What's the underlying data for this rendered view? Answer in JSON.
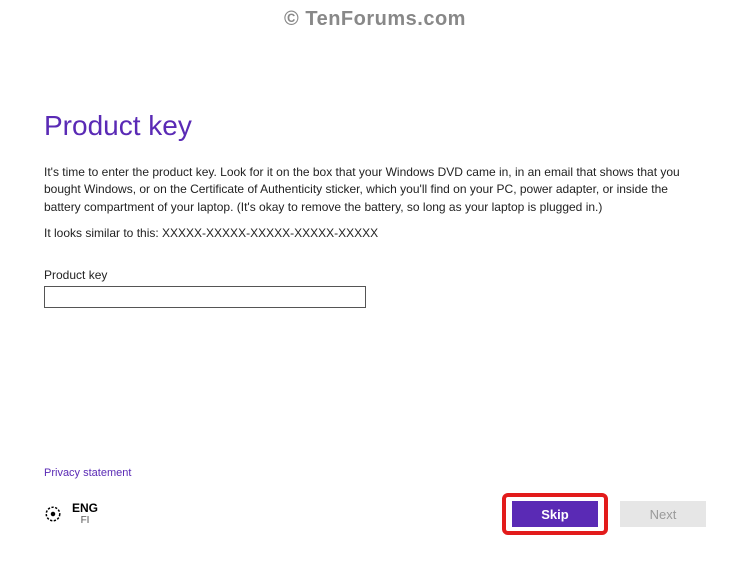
{
  "watermark": "© TenForums.com",
  "title": "Product key",
  "description": "It's time to enter the product key. Look for it on the box that your Windows DVD came in, in an email that shows that you bought Windows, or on the Certificate of Authenticity sticker, which you'll find on your PC, power adapter, or inside the battery compartment of your laptop. (It's okay to remove the battery, so long as your laptop is plugged in.)",
  "example": "It looks similar to this: XXXXX-XXXXX-XXXXX-XXXXX-XXXXX",
  "field": {
    "label": "Product key",
    "value": ""
  },
  "privacy_link": "Privacy statement",
  "language": {
    "code": "ENG",
    "region": "FI"
  },
  "buttons": {
    "skip": "Skip",
    "next": "Next"
  }
}
